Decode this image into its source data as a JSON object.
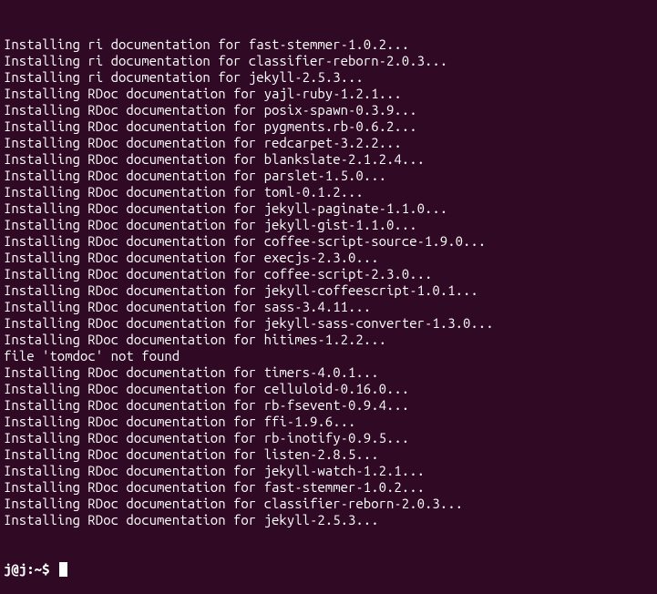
{
  "lines": [
    "Installing ri documentation for fast-stemmer-1.0.2...",
    "Installing ri documentation for classifier-reborn-2.0.3...",
    "Installing ri documentation for jekyll-2.5.3...",
    "Installing RDoc documentation for yajl-ruby-1.2.1...",
    "Installing RDoc documentation for posix-spawn-0.3.9...",
    "Installing RDoc documentation for pygments.rb-0.6.2...",
    "Installing RDoc documentation for redcarpet-3.2.2...",
    "Installing RDoc documentation for blankslate-2.1.2.4...",
    "Installing RDoc documentation for parslet-1.5.0...",
    "Installing RDoc documentation for toml-0.1.2...",
    "Installing RDoc documentation for jekyll-paginate-1.1.0...",
    "Installing RDoc documentation for jekyll-gist-1.1.0...",
    "Installing RDoc documentation for coffee-script-source-1.9.0...",
    "Installing RDoc documentation for execjs-2.3.0...",
    "Installing RDoc documentation for coffee-script-2.3.0...",
    "Installing RDoc documentation for jekyll-coffeescript-1.0.1...",
    "Installing RDoc documentation for sass-3.4.11...",
    "Installing RDoc documentation for jekyll-sass-converter-1.3.0...",
    "Installing RDoc documentation for hitimes-1.2.2...",
    "file 'tomdoc' not found",
    "Installing RDoc documentation for timers-4.0.1...",
    "Installing RDoc documentation for celluloid-0.16.0...",
    "Installing RDoc documentation for rb-fsevent-0.9.4...",
    "Installing RDoc documentation for ffi-1.9.6...",
    "Installing RDoc documentation for rb-inotify-0.9.5...",
    "Installing RDoc documentation for listen-2.8.5...",
    "Installing RDoc documentation for jekyll-watch-1.2.1...",
    "Installing RDoc documentation for fast-stemmer-1.0.2...",
    "Installing RDoc documentation for classifier-reborn-2.0.3...",
    "Installing RDoc documentation for jekyll-2.5.3..."
  ],
  "prompt": "j@j:~$ "
}
